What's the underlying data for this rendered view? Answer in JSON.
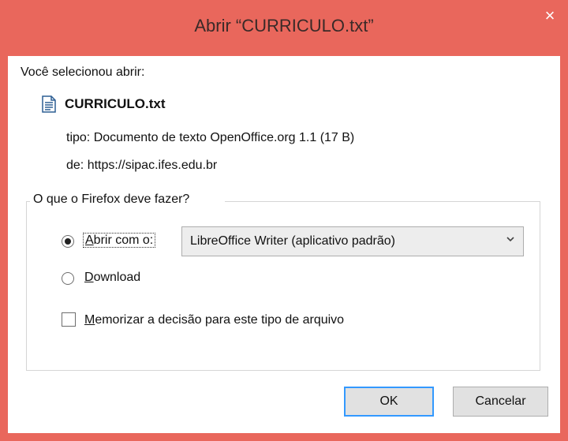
{
  "window": {
    "title": "Abrir “CURRICULO.txt”",
    "close_glyph": "×"
  },
  "dialog": {
    "selected_label": "Você selecionou abrir:",
    "file": {
      "icon": "text-document-icon",
      "name": "CURRICULO.txt"
    },
    "type_key": "tipo:",
    "type_value": "Documento de texto OpenOffice.org 1.1 (17 B)",
    "from_key": "de:",
    "from_value": "https://sipac.ifes.edu.br",
    "group_legend": "O que o Firefox deve fazer?",
    "open_with": {
      "mnemonic": "A",
      "rest": "brir com o:",
      "selected": true
    },
    "app_select": {
      "value": "LibreOffice Writer (aplicativo padrão)"
    },
    "download": {
      "mnemonic": "D",
      "rest": "ownload",
      "selected": false
    },
    "remember": {
      "mnemonic": "M",
      "rest": "emorizar a decisão para este tipo de arquivo",
      "checked": false
    },
    "ok_label": "OK",
    "cancel_label": "Cancelar"
  },
  "colors": {
    "titlebar": "#e9675c",
    "accent": "#3399ff"
  }
}
